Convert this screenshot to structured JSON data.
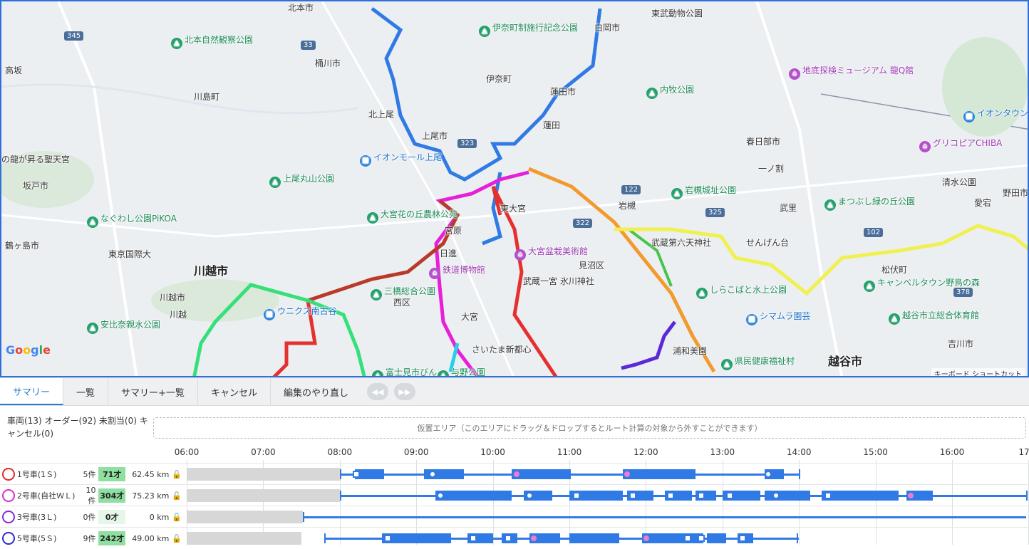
{
  "map": {
    "labels": [
      {
        "t": "北本市",
        "c": ""
      },
      {
        "t": "北本自然観察公園",
        "c": "park"
      },
      {
        "t": "桶川市",
        "c": ""
      },
      {
        "t": "川島町",
        "c": ""
      },
      {
        "t": "北上尾",
        "c": ""
      },
      {
        "t": "上尾市",
        "c": ""
      },
      {
        "t": "イオンモール上尾",
        "c": "shop"
      },
      {
        "t": "伊奈町制施行記念公園",
        "c": "park"
      },
      {
        "t": "伊奈町",
        "c": ""
      },
      {
        "t": "白岡市",
        "c": ""
      },
      {
        "t": "東武動物公園",
        "c": ""
      },
      {
        "t": "蓮田市",
        "c": ""
      },
      {
        "t": "内牧公園",
        "c": "park"
      },
      {
        "t": "地底探検ミュージアム 龍Q館",
        "c": "poi"
      },
      {
        "t": "イオンタウン",
        "c": "shop"
      },
      {
        "t": "春日部市",
        "c": ""
      },
      {
        "t": "グリコピアCHIBA",
        "c": "poi"
      },
      {
        "t": "上尾丸山公園",
        "c": "park"
      },
      {
        "t": "坂戸市",
        "c": ""
      },
      {
        "t": "なぐわし公園PiKOA",
        "c": "park"
      },
      {
        "t": "鶴ヶ島市",
        "c": ""
      },
      {
        "t": "東京国際大",
        "c": ""
      },
      {
        "t": "大宮花の丘農林公苑",
        "c": "park"
      },
      {
        "t": "東大宮",
        "c": ""
      },
      {
        "t": "岩槻城址公園",
        "c": "park"
      },
      {
        "t": "まつぶし緑の丘公園",
        "c": "park"
      },
      {
        "t": "清水公園",
        "c": ""
      },
      {
        "t": "野田市",
        "c": ""
      },
      {
        "t": "武蔵第六天神社",
        "c": ""
      },
      {
        "t": "せんげん台",
        "c": ""
      },
      {
        "t": "大宮盆栽美術館",
        "c": "poi"
      },
      {
        "t": "鉄道博物館",
        "c": "poi"
      },
      {
        "t": "見沼区",
        "c": ""
      },
      {
        "t": "川越市",
        "c": "big"
      },
      {
        "t": "武蔵一宮 氷川神社",
        "c": ""
      },
      {
        "t": "松伏町",
        "c": ""
      },
      {
        "t": "キャンベルタウン野鳥の森",
        "c": "park"
      },
      {
        "t": "ウニクス南古谷",
        "c": "shop"
      },
      {
        "t": "三橋総合公園",
        "c": "park"
      },
      {
        "t": "西区",
        "c": ""
      },
      {
        "t": "しらこばと水上公園",
        "c": "park"
      },
      {
        "t": "越谷市立総合体育館",
        "c": "park"
      },
      {
        "t": "シマムラ園芸",
        "c": "shop"
      },
      {
        "t": "安比奈親水公園",
        "c": "park"
      },
      {
        "t": "大宮",
        "c": ""
      },
      {
        "t": "さいたま新都心",
        "c": ""
      },
      {
        "t": "浦和美園",
        "c": ""
      },
      {
        "t": "県民健康福祉村",
        "c": "park"
      },
      {
        "t": "越谷市",
        "c": "big"
      },
      {
        "t": "吉川市",
        "c": ""
      },
      {
        "t": "富士見市びん",
        "c": "park"
      },
      {
        "t": "与野公園",
        "c": "park"
      },
      {
        "t": "岩槻",
        "c": ""
      },
      {
        "t": "武里",
        "c": ""
      },
      {
        "t": "一ノ割",
        "c": ""
      },
      {
        "t": "川越",
        "c": ""
      },
      {
        "t": "川越市",
        "c": ""
      },
      {
        "t": "宮原",
        "c": ""
      },
      {
        "t": "日進",
        "c": ""
      },
      {
        "t": "高坂",
        "c": ""
      },
      {
        "t": "の龍が昇る聖天宮",
        "c": ""
      },
      {
        "t": "愛宕",
        "c": ""
      },
      {
        "t": "蓮田",
        "c": ""
      }
    ],
    "attribution": "キーボード ショートカット",
    "google": "Google"
  },
  "tabs": [
    {
      "label": "サマリー",
      "active": true
    },
    {
      "label": "一覧",
      "active": false
    },
    {
      "label": "サマリー+一覧",
      "active": false
    },
    {
      "label": "キャンセル",
      "active": false
    },
    {
      "label": "編集のやり直し",
      "active": false
    }
  ],
  "summary": {
    "text": "車両(13) オーダー(92) 未割当(0) キャンセル(0)"
  },
  "drop_area": "仮置エリア（このエリアにドラッグ＆ドロップするとルート計算の対象から外すことができます）",
  "timeline": {
    "hours": [
      "06:00",
      "07:00",
      "08:00",
      "09:00",
      "10:00",
      "11:00",
      "12:00",
      "13:00",
      "14:00",
      "15:00",
      "16:00",
      "17:0"
    ],
    "vehicles": [
      {
        "name": "1号車(1Ｓ)",
        "color": "#e02a2a",
        "count": "5件",
        "cap": "71才",
        "dist": "62.45 km"
      },
      {
        "name": "2号車(自社ＷＬ)",
        "color": "#e02ad0",
        "count": "10件",
        "cap": "304才",
        "dist": "75.23 km"
      },
      {
        "name": "3号車(3Ｌ)",
        "color": "#8a2ad0",
        "count": "0件",
        "cap": "0才",
        "dist": "0 km"
      },
      {
        "name": "5号車(5Ｓ)",
        "color": "#2a2ad0",
        "count": "9件",
        "cap": "242才",
        "dist": "49.00 km"
      }
    ]
  }
}
